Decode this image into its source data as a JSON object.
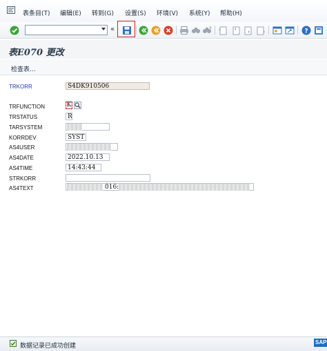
{
  "menu": {
    "items": [
      "表条目(T)",
      "编辑(E)",
      "转到(G)",
      "设置(S)",
      "环境(V)",
      "系统(Y)",
      "帮助(H)"
    ]
  },
  "toolbar": {
    "command_value": "",
    "collapse_glyph": "«",
    "icons": [
      "enter-icon",
      "save-icon",
      "back-icon",
      "exit-icon",
      "cancel-icon",
      "print-icon",
      "find-icon",
      "find-next-icon",
      "first-page-icon",
      "previous-page-icon",
      "next-page-icon",
      "last-page-icon",
      "create-session-icon",
      "shortcut-icon",
      "help-icon",
      "customize-layout-icon"
    ]
  },
  "title": "表E070 更改",
  "app_toolbar": {
    "check_table_label": "检查表..."
  },
  "form": {
    "fields": [
      {
        "label": "TRKORR",
        "value": "S4DK910506"
      },
      {
        "label": "TRFUNCTION",
        "value": "K"
      },
      {
        "label": "TRSTATUS",
        "value": "R"
      },
      {
        "label": "TARSYSTEM",
        "value": ""
      },
      {
        "label": "KORRDEV",
        "value": "SYST"
      },
      {
        "label": "AS4USER",
        "value": ""
      },
      {
        "label": "AS4DATE",
        "value": "2022.10.13"
      },
      {
        "label": "AS4TIME",
        "value": "14:43:44"
      },
      {
        "label": "STRKORR",
        "value": ""
      },
      {
        "label": "AS4TEXT",
        "value": "016:"
      }
    ]
  },
  "status": {
    "message": "数据记录已成功创建"
  },
  "brand": "SAP",
  "colors": {
    "highlight": "#d62020",
    "link_label": "#1f3ea8",
    "status_ok": "#3d7a2d"
  }
}
